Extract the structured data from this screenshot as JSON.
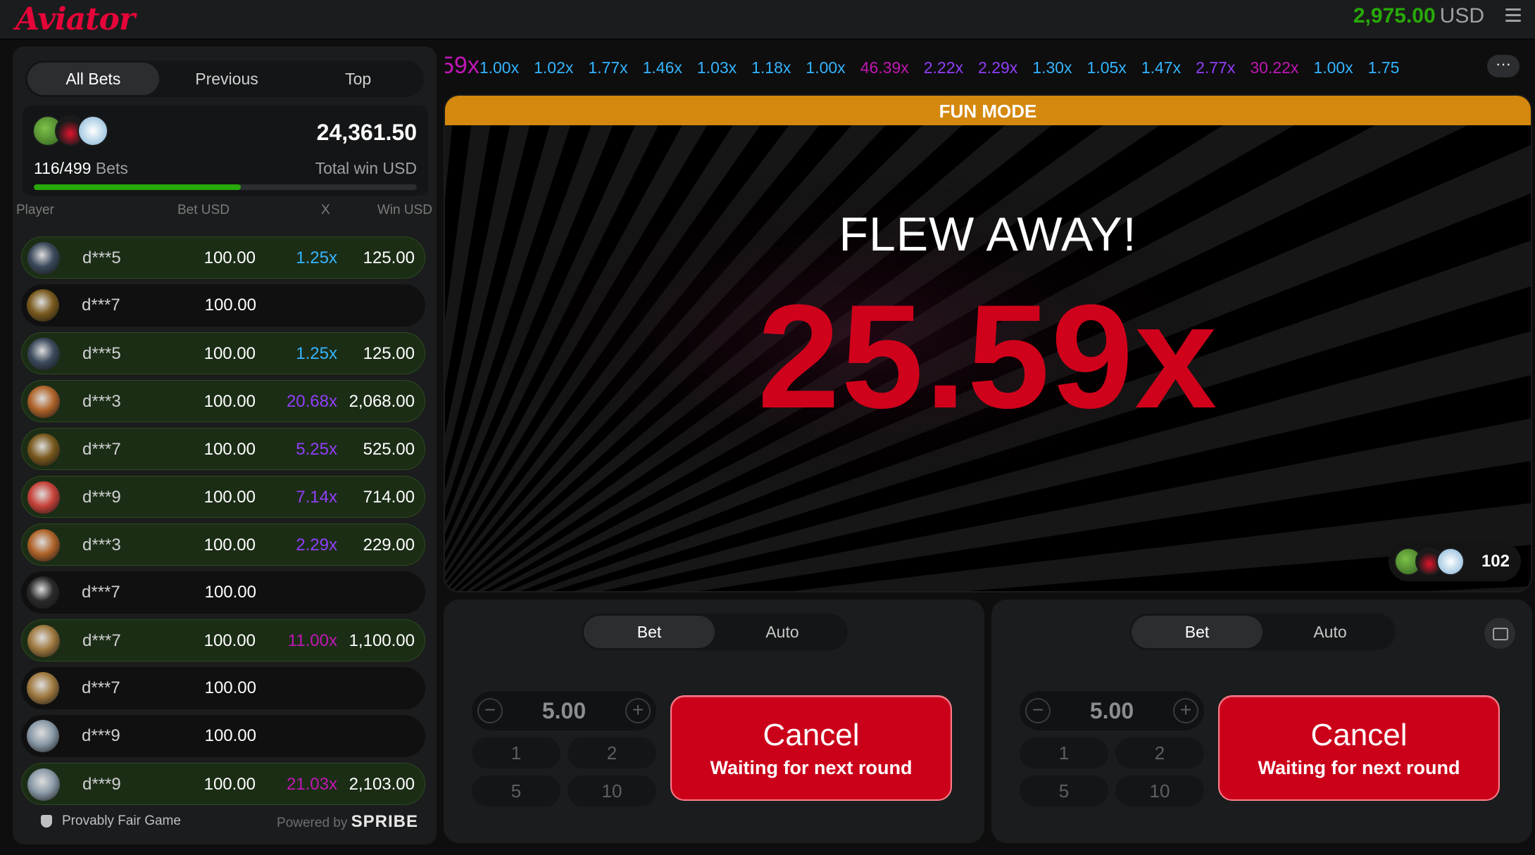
{
  "header": {
    "logo": "Aviator",
    "balance_amount": "2,975.00",
    "balance_currency": "USD"
  },
  "left_panel": {
    "tabs": [
      "All Bets",
      "Previous",
      "Top"
    ],
    "active_tab": "All Bets",
    "bets_count": "116/499",
    "bets_label": "Bets",
    "total_win": "24,361.50",
    "total_win_label": "Total win USD",
    "progress_ratio": 0.54,
    "columns": [
      "Player",
      "Bet USD",
      "X",
      "Win USD"
    ],
    "rows": [
      {
        "player": "d***5",
        "bet": "100.00",
        "mult": "1.25x",
        "win": "125.00",
        "won": true,
        "mult_color": "#34b4ff",
        "avatar_color": "#3b4a5c"
      },
      {
        "player": "d***7",
        "bet": "100.00",
        "mult": "",
        "win": "",
        "won": false,
        "mult_color": "",
        "avatar_color": "#7a5a1e"
      },
      {
        "player": "d***5",
        "bet": "100.00",
        "mult": "1.25x",
        "win": "125.00",
        "won": true,
        "mult_color": "#34b4ff",
        "avatar_color": "#3b4a5c"
      },
      {
        "player": "d***3",
        "bet": "100.00",
        "mult": "20.68x",
        "win": "2,068.00",
        "won": true,
        "mult_color": "#913ef8",
        "avatar_color": "#b0642a"
      },
      {
        "player": "d***7",
        "bet": "100.00",
        "mult": "5.25x",
        "win": "525.00",
        "won": true,
        "mult_color": "#913ef8",
        "avatar_color": "#7a5a1e"
      },
      {
        "player": "d***9",
        "bet": "100.00",
        "mult": "7.14x",
        "win": "714.00",
        "won": true,
        "mult_color": "#913ef8",
        "avatar_color": "#c8433a"
      },
      {
        "player": "d***3",
        "bet": "100.00",
        "mult": "2.29x",
        "win": "229.00",
        "won": true,
        "mult_color": "#913ef8",
        "avatar_color": "#b0642a"
      },
      {
        "player": "d***7",
        "bet": "100.00",
        "mult": "",
        "win": "",
        "won": false,
        "mult_color": "",
        "avatar_color": "#2a2a2a"
      },
      {
        "player": "d***7",
        "bet": "100.00",
        "mult": "11.00x",
        "win": "1,100.00",
        "won": true,
        "mult_color": "#c017b4",
        "avatar_color": "#a07a40"
      },
      {
        "player": "d***7",
        "bet": "100.00",
        "mult": "",
        "win": "",
        "won": false,
        "mult_color": "",
        "avatar_color": "#a07a40"
      },
      {
        "player": "d***9",
        "bet": "100.00",
        "mult": "",
        "win": "",
        "won": false,
        "mult_color": "",
        "avatar_color": "#8a9aa8"
      },
      {
        "player": "d***9",
        "bet": "100.00",
        "mult": "21.03x",
        "win": "2,103.00",
        "won": true,
        "mult_color": "#c017b4",
        "avatar_color": "#8a9aa8"
      }
    ],
    "footer_left": "Provably Fair Game",
    "footer_powered": "Powered by",
    "footer_brand": "SPRIBE"
  },
  "history": {
    "items": [
      {
        "v": "59x",
        "c": "#c017b4"
      },
      {
        "v": "1.00x",
        "c": "#34b4ff"
      },
      {
        "v": "1.02x",
        "c": "#34b4ff"
      },
      {
        "v": "1.77x",
        "c": "#34b4ff"
      },
      {
        "v": "1.46x",
        "c": "#34b4ff"
      },
      {
        "v": "1.03x",
        "c": "#34b4ff"
      },
      {
        "v": "1.18x",
        "c": "#34b4ff"
      },
      {
        "v": "1.00x",
        "c": "#34b4ff"
      },
      {
        "v": "46.39x",
        "c": "#c017b4"
      },
      {
        "v": "2.22x",
        "c": "#913ef8"
      },
      {
        "v": "2.29x",
        "c": "#913ef8"
      },
      {
        "v": "1.30x",
        "c": "#34b4ff"
      },
      {
        "v": "1.05x",
        "c": "#34b4ff"
      },
      {
        "v": "1.47x",
        "c": "#34b4ff"
      },
      {
        "v": "2.77x",
        "c": "#913ef8"
      },
      {
        "v": "30.22x",
        "c": "#c017b4"
      },
      {
        "v": "1.00x",
        "c": "#34b4ff"
      },
      {
        "v": "1.75",
        "c": "#34b4ff"
      }
    ],
    "more_label": "···"
  },
  "stage": {
    "banner": "FUN MODE",
    "status": "FLEW AWAY!",
    "multiplier": "25.59x",
    "online_count": "102"
  },
  "bet_panels": [
    {
      "tabs": [
        "Bet",
        "Auto"
      ],
      "stake": "5.00",
      "quick": [
        "1",
        "2",
        "5",
        "10"
      ],
      "button_title": "Cancel",
      "button_sub": "Waiting for next round"
    },
    {
      "tabs": [
        "Bet",
        "Auto"
      ],
      "stake": "5.00",
      "quick": [
        "1",
        "2",
        "5",
        "10"
      ],
      "button_title": "Cancel",
      "button_sub": "Waiting for next round"
    }
  ],
  "colors": {
    "brand_red": "#e50539",
    "balance_green": "#28a909",
    "fun_mode_orange": "#d4880d",
    "multiplier_red": "#d0021b"
  }
}
